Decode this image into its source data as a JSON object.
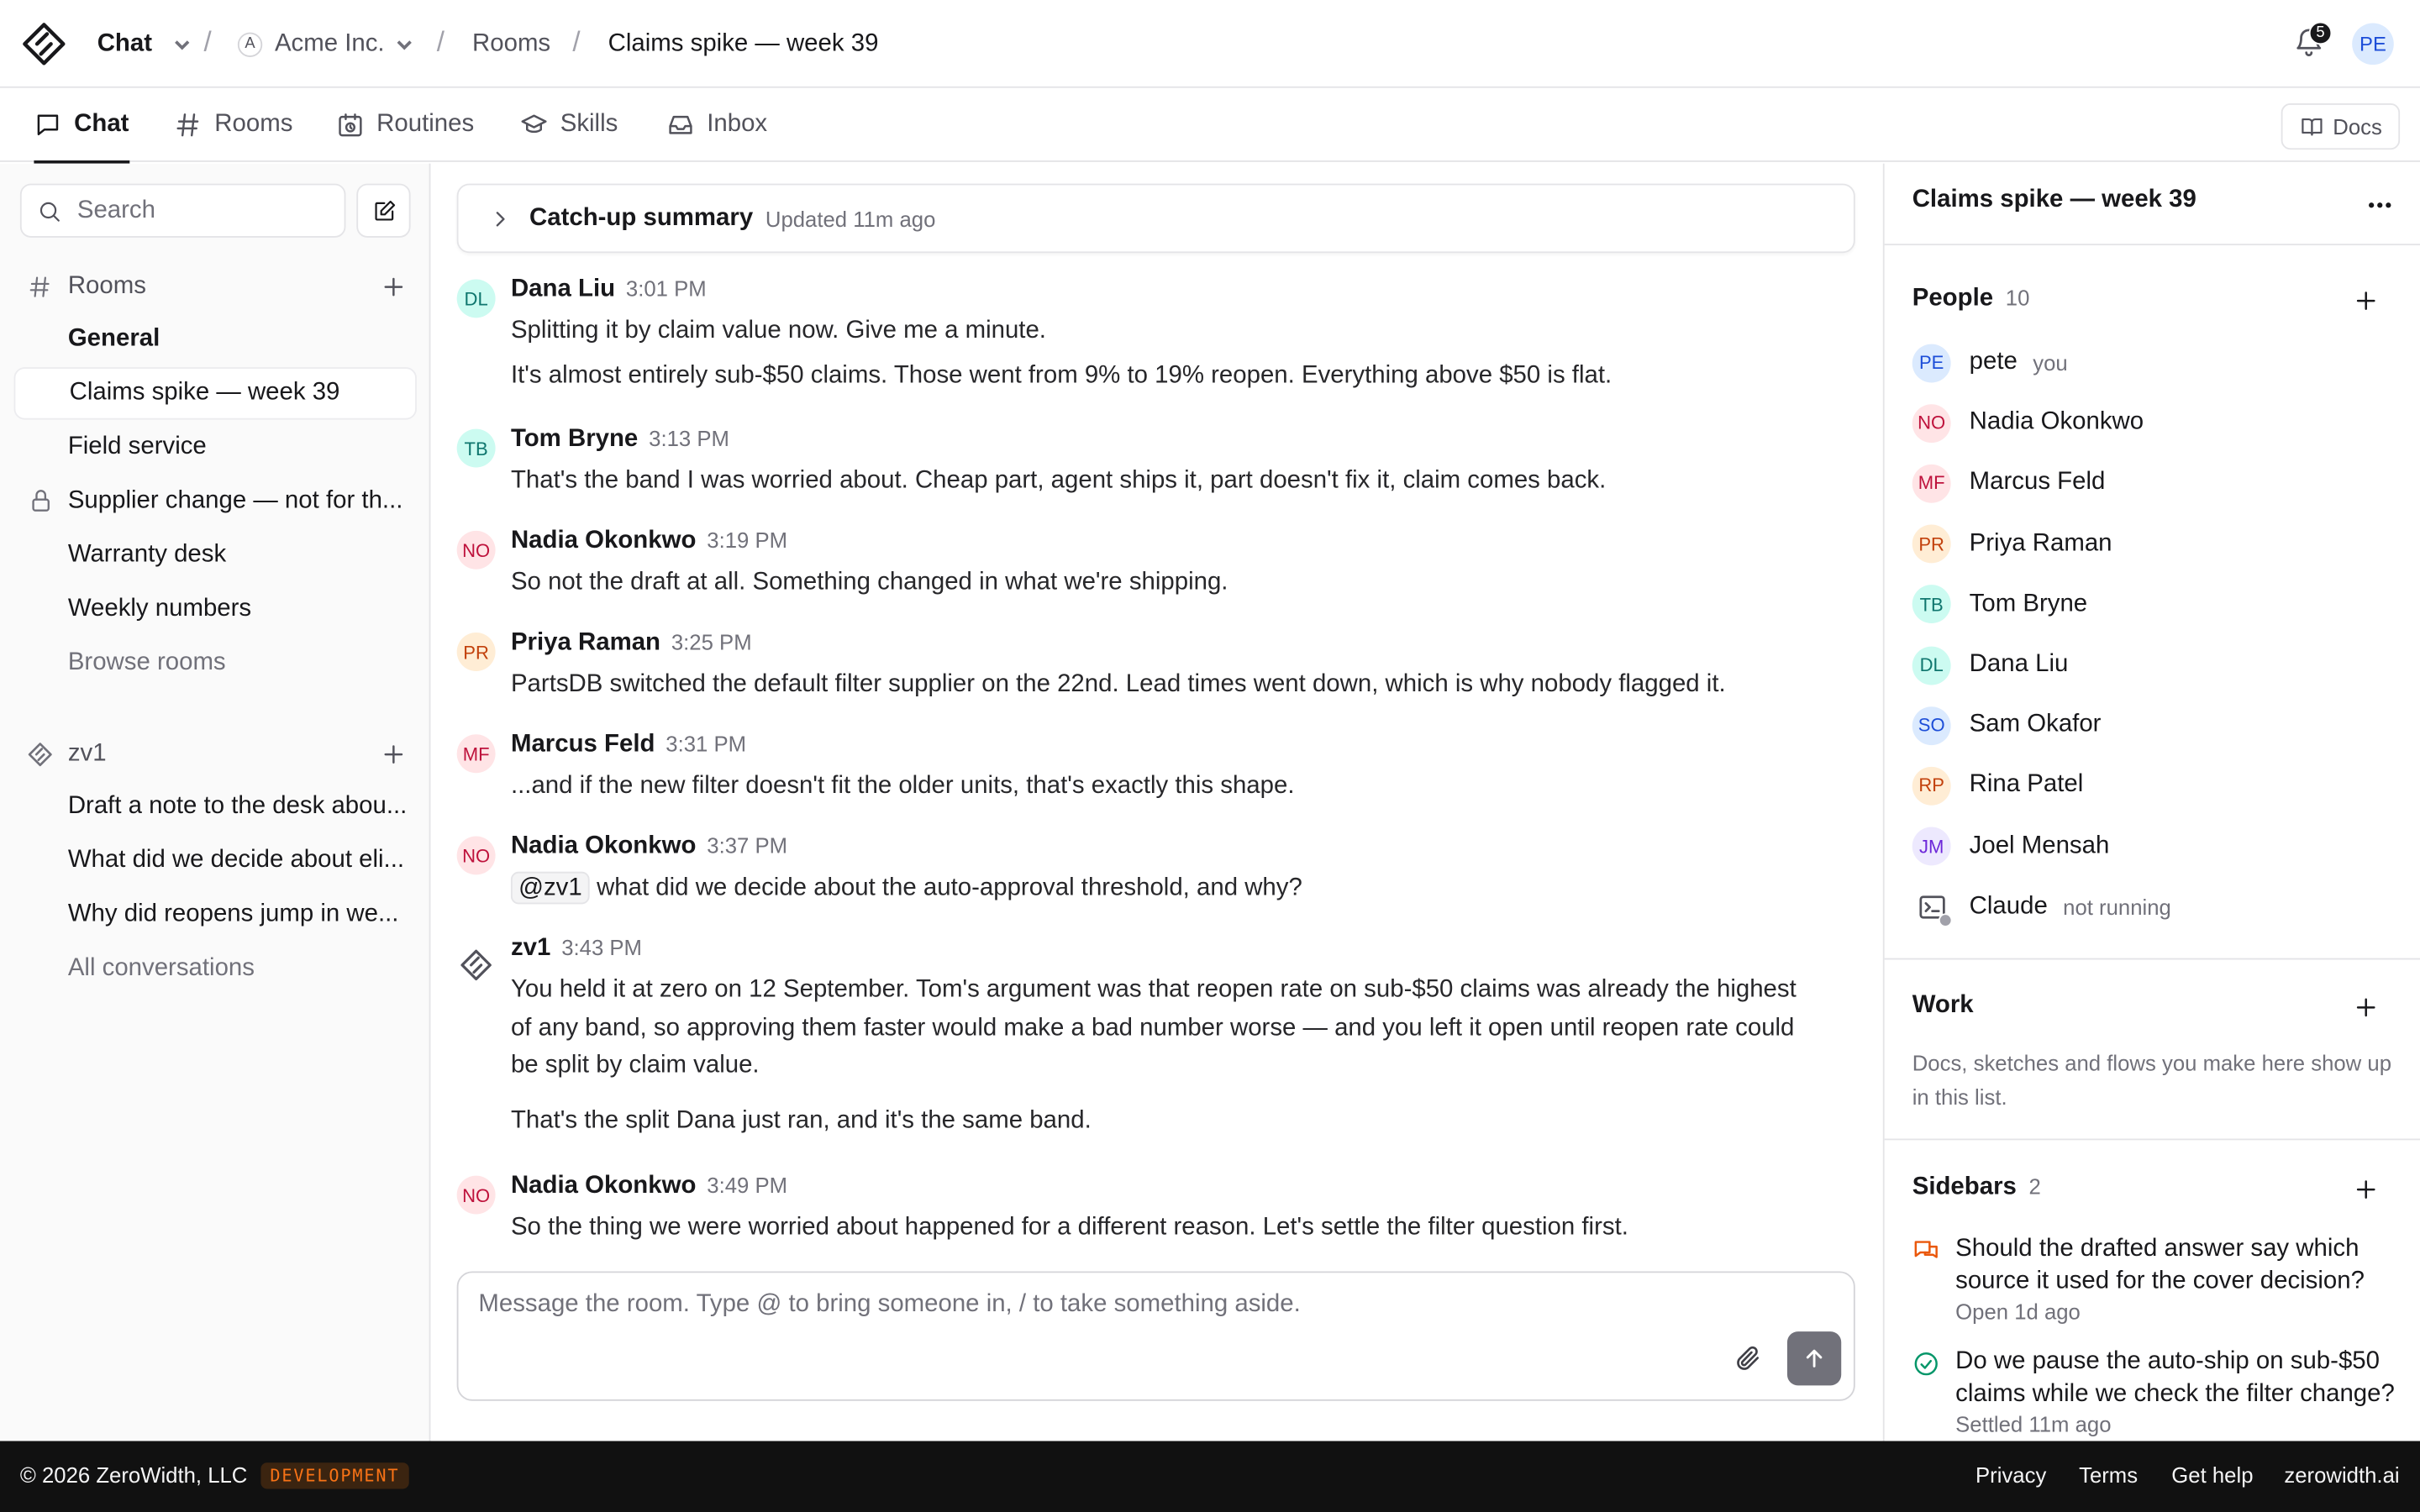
{
  "topbar": {
    "app_name": "Chat",
    "org_initial": "A",
    "org_name": "Acme Inc.",
    "rooms_crumb": "Rooms",
    "current_room": "Claims spike — week 39",
    "notification_count": "5",
    "user_initials": "PE"
  },
  "nav": {
    "tabs": [
      {
        "label": "Chat",
        "icon": "chat-bubble-icon",
        "active": true
      },
      {
        "label": "Rooms",
        "icon": "hash-icon"
      },
      {
        "label": "Routines",
        "icon": "calendar-clock-icon"
      },
      {
        "label": "Skills",
        "icon": "graduation-cap-icon"
      },
      {
        "label": "Inbox",
        "icon": "inbox-icon"
      }
    ],
    "docs_label": "Docs"
  },
  "sidebar": {
    "search_placeholder": "Search",
    "rooms_heading": "Rooms",
    "rooms": [
      {
        "label": "General",
        "bold": true
      },
      {
        "label": "Claims spike — week 39",
        "selected": true
      },
      {
        "label": "Field service"
      },
      {
        "label": "Supplier change — not for th...",
        "locked": true
      },
      {
        "label": "Warranty desk"
      },
      {
        "label": "Weekly numbers"
      }
    ],
    "browse_rooms": "Browse rooms",
    "agent_heading": "zv1",
    "conversations": [
      {
        "label": "Draft a note to the desk abou..."
      },
      {
        "label": "What did we decide about eli..."
      },
      {
        "label": "Why did reopens jump in we..."
      }
    ],
    "all_conversations": "All conversations"
  },
  "summary": {
    "title": "Catch-up summary",
    "updated": "Updated 11m ago"
  },
  "messages": [
    {
      "initials": "DL",
      "name": "Dana Liu",
      "time": "3:01 PM",
      "lines": [
        "Splitting it by claim value now. Give me a minute.",
        "It's almost entirely sub-$50 claims. Those went from 9% to 19% reopen. Everything above $50 is flat."
      ]
    },
    {
      "initials": "TB",
      "name": "Tom Bryne",
      "time": "3:13 PM",
      "lines": [
        "That's the band I was worried about. Cheap part, agent ships it, part doesn't fix it, claim comes back."
      ]
    },
    {
      "initials": "NO",
      "name": "Nadia Okonkwo",
      "time": "3:19 PM",
      "lines": [
        "So not the draft at all. Something changed in what we're shipping."
      ]
    },
    {
      "initials": "PR",
      "name": "Priya Raman",
      "time": "3:25 PM",
      "lines": [
        "PartsDB switched the default filter supplier on the 22nd. Lead times went down, which is why nobody flagged it."
      ]
    },
    {
      "initials": "MF",
      "name": "Marcus Feld",
      "time": "3:31 PM",
      "lines": [
        "...and if the new filter doesn't fit the older units, that's exactly this shape."
      ]
    },
    {
      "initials": "NO",
      "name": "Nadia Okonkwo",
      "time": "3:37 PM",
      "mention": "@zv1",
      "lines": [
        "what did we decide about the auto-approval threshold, and why?"
      ]
    },
    {
      "name": "zv1",
      "time": "3:43 PM",
      "lines": [
        "You held it at zero on 12 September. Tom's argument was that reopen rate on sub-$50 claims was already the highest of any band, so approving them faster would make a bad number worse — and you left it open until reopen rate could be split by claim value.",
        "That's the split Dana just ran, and it's the same band."
      ]
    },
    {
      "initials": "NO",
      "name": "Nadia Okonkwo",
      "time": "3:49 PM",
      "lines": [
        "So the thing we were worried about happened for a different reason. Let's settle the filter question first."
      ]
    }
  ],
  "composer": {
    "placeholder": "Message the room. Type @ to bring someone in, / to take something aside."
  },
  "panel": {
    "title": "Claims spike — week 39",
    "people_heading": "People",
    "people_count": "10",
    "people": [
      {
        "initials": "PE",
        "name": "pete",
        "note": "you"
      },
      {
        "initials": "NO",
        "name": "Nadia Okonkwo"
      },
      {
        "initials": "MF",
        "name": "Marcus Feld"
      },
      {
        "initials": "PR",
        "name": "Priya Raman"
      },
      {
        "initials": "TB",
        "name": "Tom Bryne"
      },
      {
        "initials": "DL",
        "name": "Dana Liu"
      },
      {
        "initials": "SO",
        "name": "Sam Okafor"
      },
      {
        "initials": "RP",
        "name": "Rina Patel"
      },
      {
        "initials": "JM",
        "name": "Joel Mensah"
      },
      {
        "name": "Claude",
        "note": "not running"
      }
    ],
    "work_heading": "Work",
    "work_hint": "Docs, sketches and flows you make here show up in this list.",
    "sidebars_heading": "Sidebars",
    "sidebars_count": "2",
    "sidebars": [
      {
        "title": "Should the drafted answer say which source it used for the cover decision?",
        "status": "Open 1d ago",
        "icon": "chat-bubbles-icon"
      },
      {
        "title": "Do we pause the auto-ship on sub-$50 claims while we check the filter change?",
        "status": "Settled 11m ago",
        "icon": "check-circle-icon"
      }
    ]
  },
  "footer": {
    "copyright": "© 2026 ZeroWidth, LLC",
    "env_badge": "DEVELOPMENT",
    "links": [
      "Privacy",
      "Terms",
      "Get help",
      "zerowidth.ai"
    ]
  },
  "colors": {
    "DL": {
      "bg": "#ccfbf1",
      "fg": "#0f766e"
    },
    "TB": {
      "bg": "#ccfbf1",
      "fg": "#0f766e"
    },
    "NO": {
      "bg": "#ffe4e6",
      "fg": "#be123c"
    },
    "PR": {
      "bg": "#ffedd5",
      "fg": "#c2410c"
    },
    "MF": {
      "bg": "#ffe4e6",
      "fg": "#be123c"
    },
    "PE": {
      "bg": "#dbeafe",
      "fg": "#1d4ed8"
    },
    "SO": {
      "bg": "#dbeafe",
      "fg": "#1d4ed8"
    },
    "RP": {
      "bg": "#ffedd5",
      "fg": "#c2410c"
    },
    "JM": {
      "bg": "#ede9fe",
      "fg": "#6d28d9"
    }
  }
}
